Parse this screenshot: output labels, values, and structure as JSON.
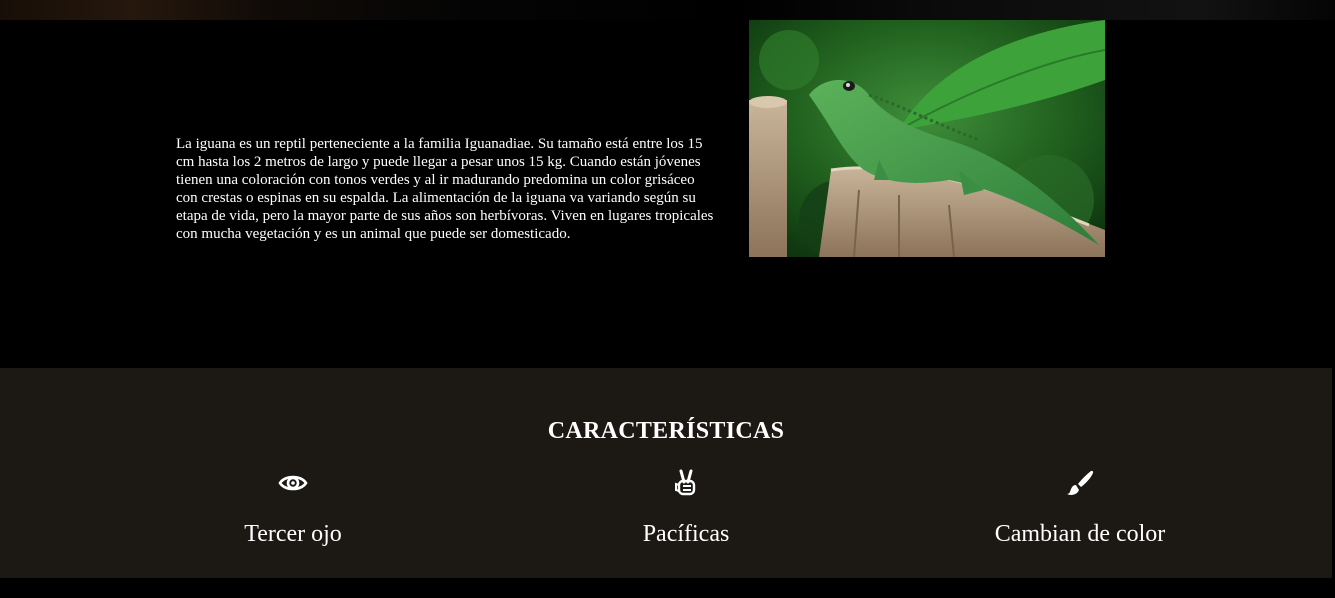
{
  "intro": {
    "paragraph": "La iguana es un reptil perteneciente a la familia Iguanadiae. Su tamaño está entre los 15 cm hasta los 2 metros de largo y puede llegar a pesar unos 15 kg. Cuando están jóvenes tienen una coloración con tonos verdes y al ir madurando predomina un color grisáceo con crestas o espinas en su espalda. La alimentación de la iguana va variando según su etapa de vida, pero la mayor parte de sus años son herbívoras. Viven en lugares tropicales con mucha vegetación y es un animal que puede ser domesticado."
  },
  "features": {
    "title": "CARACTERÍSTICAS",
    "items": [
      {
        "icon": "eye-icon",
        "label": "Tercer ojo"
      },
      {
        "icon": "peace-hand-icon",
        "label": "Pacíficas"
      },
      {
        "icon": "paint-brush-icon",
        "label": "Cambian de color"
      }
    ]
  },
  "colors": {
    "page_background": "#000000",
    "features_background": "#1c1813",
    "text": "#ffffff"
  }
}
